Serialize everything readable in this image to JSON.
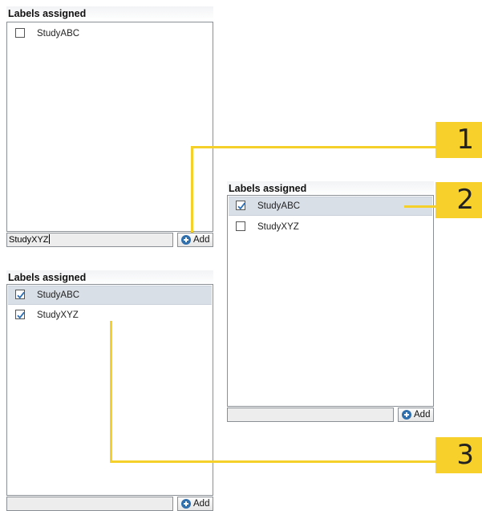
{
  "panel_a": {
    "title": "Labels assigned",
    "items": [
      {
        "label": "StudyABC",
        "checked": false
      }
    ],
    "input_value": "StudyXYZ",
    "add_label": "Add"
  },
  "panel_b": {
    "title": "Labels assigned",
    "items": [
      {
        "label": "StudyABC",
        "checked": true,
        "selected": true
      },
      {
        "label": "StudyXYZ",
        "checked": false
      }
    ],
    "input_value": "",
    "add_label": "Add"
  },
  "panel_c": {
    "title": "Labels assigned",
    "items": [
      {
        "label": "StudyABC",
        "checked": true,
        "selected": true
      },
      {
        "label": "StudyXYZ",
        "checked": true
      }
    ],
    "input_value": "",
    "add_label": "Add"
  },
  "callouts": [
    "1",
    "2",
    "3"
  ],
  "colors": {
    "callout": "#f5cf2a",
    "selected_row": "#d9dfe7",
    "checkmark": "#2d6fb5"
  }
}
